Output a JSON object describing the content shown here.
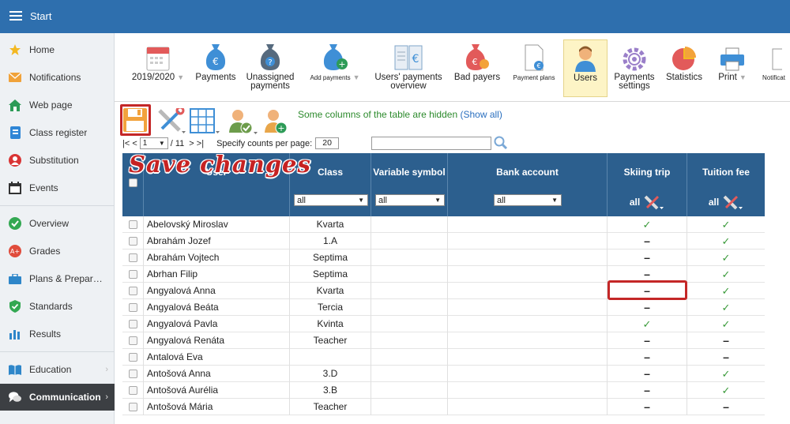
{
  "header": {
    "title": "Start"
  },
  "sidebar": {
    "items": [
      {
        "label": "Home"
      },
      {
        "label": "Notifications"
      },
      {
        "label": "Web page"
      },
      {
        "label": "Class register"
      },
      {
        "label": "Substitution"
      },
      {
        "label": "Events"
      },
      {
        "label": "Overview"
      },
      {
        "label": "Grades"
      },
      {
        "label": "Plans & Prepar…"
      },
      {
        "label": "Standards"
      },
      {
        "label": "Results"
      },
      {
        "label": "Education"
      },
      {
        "label": "Communication"
      }
    ]
  },
  "toolbar": {
    "items": [
      {
        "label": "2019/2020"
      },
      {
        "label": "Payments"
      },
      {
        "label": "Unassigned payments"
      },
      {
        "label": "Add payments"
      },
      {
        "label": "Users' payments overview"
      },
      {
        "label": "Bad payers"
      },
      {
        "label": "Payment plans"
      },
      {
        "label": "Users"
      },
      {
        "label": "Payments settings"
      },
      {
        "label": "Statistics"
      },
      {
        "label": "Print"
      },
      {
        "label": "Notificat"
      }
    ]
  },
  "subbar": {
    "hidden_note": "Some columns of the table are hidden",
    "show_all": "(Show all)",
    "pager_first": "|< <",
    "pager_page": "1",
    "pager_total": "/ 11",
    "pager_next": "> >|",
    "counts_label": "Specify counts per page:",
    "counts_value": "20",
    "search_placeholder": ""
  },
  "annotation": {
    "text": "Save changes"
  },
  "table": {
    "columns": {
      "user": "User",
      "class": "Class",
      "variable_symbol": "Variable symbol",
      "bank_account": "Bank account",
      "skiing_trip": "Skiing trip",
      "tuition_fee": "Tuition fee"
    },
    "filters": {
      "class": "all",
      "variable_symbol": "all",
      "bank_account": "all",
      "skiing_trip": "all",
      "tuition_fee": "all"
    },
    "rows": [
      {
        "name": "Abelovský Miroslav",
        "class": "Kvarta",
        "skiing": "check",
        "tuition": "check"
      },
      {
        "name": "Abrahám Jozef",
        "class": "1.A",
        "skiing": "dash",
        "tuition": "check"
      },
      {
        "name": "Abrahám Vojtech",
        "class": "Septima",
        "skiing": "dash",
        "tuition": "check"
      },
      {
        "name": "Abrhan Filip",
        "class": "Septima",
        "skiing": "dash",
        "tuition": "check"
      },
      {
        "name": "Angyalová Anna",
        "class": "Kvarta",
        "skiing": "dash",
        "tuition": "check"
      },
      {
        "name": "Angyalová Beáta",
        "class": "Tercia",
        "skiing": "dash",
        "tuition": "check"
      },
      {
        "name": "Angyalová Pavla",
        "class": "Kvinta",
        "skiing": "check",
        "tuition": "check"
      },
      {
        "name": "Angyalová Renáta",
        "class": "Teacher",
        "skiing": "dash",
        "tuition": "dash"
      },
      {
        "name": "Antalová Eva",
        "class": "",
        "skiing": "dash",
        "tuition": "dash"
      },
      {
        "name": "Antošová Anna",
        "class": "3.D",
        "skiing": "dash",
        "tuition": "check"
      },
      {
        "name": "Antošová Aurélia",
        "class": "3.B",
        "skiing": "dash",
        "tuition": "check"
      },
      {
        "name": "Antošová Mária",
        "class": "Teacher",
        "skiing": "dash",
        "tuition": "dash"
      }
    ]
  },
  "colors": {
    "topbar": "#2e6fae",
    "table_header": "#2c5f8e",
    "highlight": "#c42727",
    "check": "#3a9a3a"
  }
}
